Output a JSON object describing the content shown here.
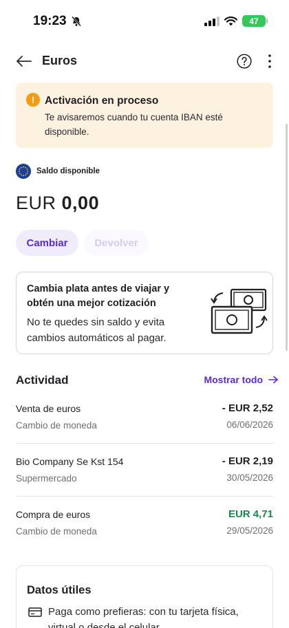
{
  "status_bar": {
    "time": "19:23",
    "battery": "47"
  },
  "header": {
    "title": "Euros"
  },
  "notice": {
    "title": "Activación en proceso",
    "body": "Te avisaremos cuando tu cuenta IBAN esté disponible."
  },
  "balance": {
    "label": "Saldo disponible",
    "currency": "EUR",
    "amount": "0,00"
  },
  "actions": {
    "change_label": "Cambiar",
    "return_label": "Devolver"
  },
  "promo": {
    "title": "Cambia plata antes de viajar y obtén una mejor cotización",
    "body": "No te quedes sin saldo y evita cambios automáticos al pagar."
  },
  "activity": {
    "title": "Actividad",
    "show_all": "Mostrar todo",
    "transactions": [
      {
        "name": "Venta de euros",
        "category": "Cambio de moneda",
        "amount": "- EUR 2,52",
        "date": "06/06/2026",
        "type": "debit"
      },
      {
        "name": "Bio Company Se Kst 154",
        "category": "Supermercado",
        "amount": "- EUR 2,19",
        "date": "30/05/2026",
        "type": "debit"
      },
      {
        "name": "Compra de euros",
        "category": "Cambio de moneda",
        "amount": "EUR 4,71",
        "date": "29/05/2026",
        "type": "credit"
      }
    ]
  },
  "useful_info": {
    "title": "Datos útiles",
    "items": [
      {
        "icon": "card-icon",
        "text": "Paga como prefieras: con tu tarjeta física, virtual o desde el celular."
      }
    ]
  },
  "colors": {
    "accent": "#5a2bd1",
    "notice_bg": "#fdf1df",
    "warning": "#f39c12",
    "positive": "#138a4b"
  }
}
